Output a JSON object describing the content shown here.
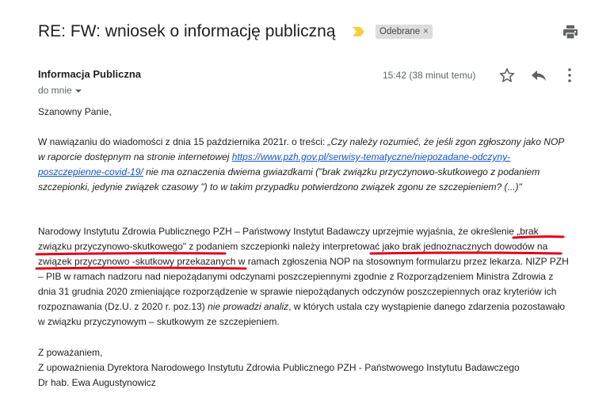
{
  "header": {
    "subject": "RE: FW: wniosek o informację publiczną",
    "label": "Odebrane",
    "label_remove": "×"
  },
  "meta": {
    "sender": "Informacja Publiczna",
    "recipient": "do mnie",
    "time": "15:42 (38 minut temu)"
  },
  "message": {
    "greeting": "Szanowny Panie,",
    "para1_prefix": "W nawiązaniu do wiadomości z dnia 15 października 2021r. o treści: ",
    "para1_quote_a": "„Czy należy rozumieć, że jeśli zgon zgłoszony jako NOP w raporcie dostępnym na stronie internetowej ",
    "para1_link": "https://www.pzh.gov.pl/serwisy-tematyczne/niepozadane-odczyny-poszczepienne-covid-19/",
    "para1_quote_b": " nie ma oznaczenia dwiema gwiazdkami (\"brak związku przyczynowo-skutkowego z podaniem szczepionki, jedynie związek czasowy \") to w takim przypadku potwierdzono związek zgonu ze szczepieniem? (...)\"",
    "para2_a": "Narodowy Instytutu Zdrowia Publicznego PZH – Państwowy Instytut Badawczy uprzejmie wyjaśnia, że określenie „brak związku przyczynowo-skutkowego\" z podaniem szczepionki należy interpretować jako brak jednoznacznych dowodów na związek przyczynowo -skutkowy przekazanych w ramach zgłoszenia NOP na stosownym formularzu przez lekarza. NIZP PZH – PIB w ramach nadzoru nad niepożądanymi odczynami poszczepiennymi zgodnie z Rozporządzeniem Ministra Zdrowia z dnia 31 grudnia 2020 zmieniające rozporządzenie w sprawie niepożądanych odczynów poszczepiennych oraz kryteriów ich rozpoznawania (Dz.U. z 2020 r. poz.13) ",
    "para2_italic": "nie prowadzi analiz",
    "para2_b": ", w których ustala czy wystąpienie danego zdarzenia pozostawało w związku przyczynowym – skutkowym ze szczepieniem.",
    "closing_1": "Z poważaniem,",
    "closing_2": "Z upoważnienia Dyrektora Narodowego Instytutu Zdrowia Publicznego PZH - Państwowego Instytutu Badawczego",
    "closing_3": "Dr hab.  Ewa Augustynowicz"
  },
  "icons": {
    "importance": "importance-marker-icon",
    "print": "print-icon",
    "star": "star-icon",
    "reply": "reply-icon",
    "more": "more-vert-icon"
  },
  "colors": {
    "importance": "#f4d03f",
    "link": "#1155cc",
    "annotation": "#e0001b",
    "label_bg": "#dddddd"
  }
}
